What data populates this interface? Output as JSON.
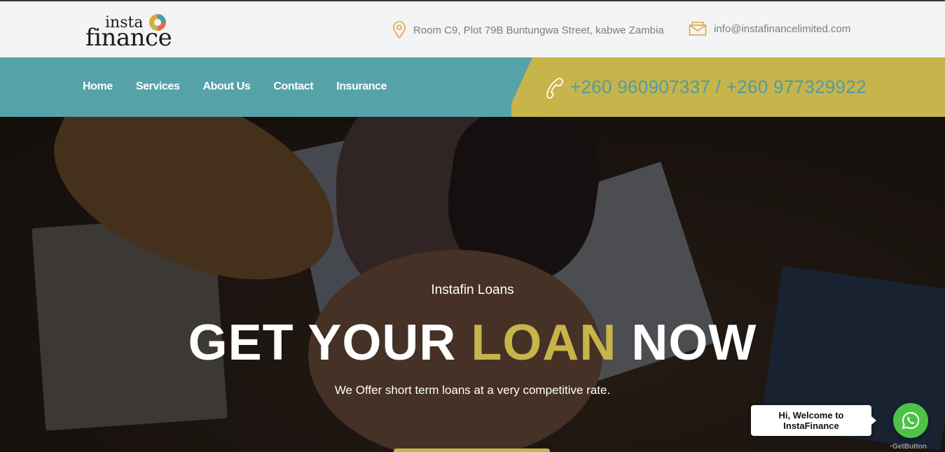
{
  "header": {
    "logo": {
      "top_text": "insta",
      "bottom_text": "finance"
    },
    "address": "Room C9, Plot 79B Buntungwa Street, kabwe Zambia",
    "email": "info@instafinancelimited.com"
  },
  "nav": {
    "items": [
      {
        "label": "Home"
      },
      {
        "label": "Services"
      },
      {
        "label": "About Us"
      },
      {
        "label": "Contact"
      },
      {
        "label": "Insurance"
      }
    ],
    "phone": "+260 960907337 / +260 977329922"
  },
  "hero": {
    "subtitle": "Instafin Loans",
    "headline_part1": "GET YOUR ",
    "headline_accent": "LOAN",
    "headline_part2": " NOW",
    "tagline": "We Offer short term loans at a very competitive rate."
  },
  "chat_widget": {
    "line1": "Hi, Welcome to",
    "line2": "InstaFinance",
    "branding": "GetButton"
  },
  "colors": {
    "teal": "#55a3a8",
    "gold": "#c7b44a",
    "whatsapp_green": "#4dc247"
  },
  "icons": {
    "address": "location-pin-icon",
    "email": "envelope-icon",
    "phone": "phone-icon",
    "whatsapp": "whatsapp-icon"
  }
}
